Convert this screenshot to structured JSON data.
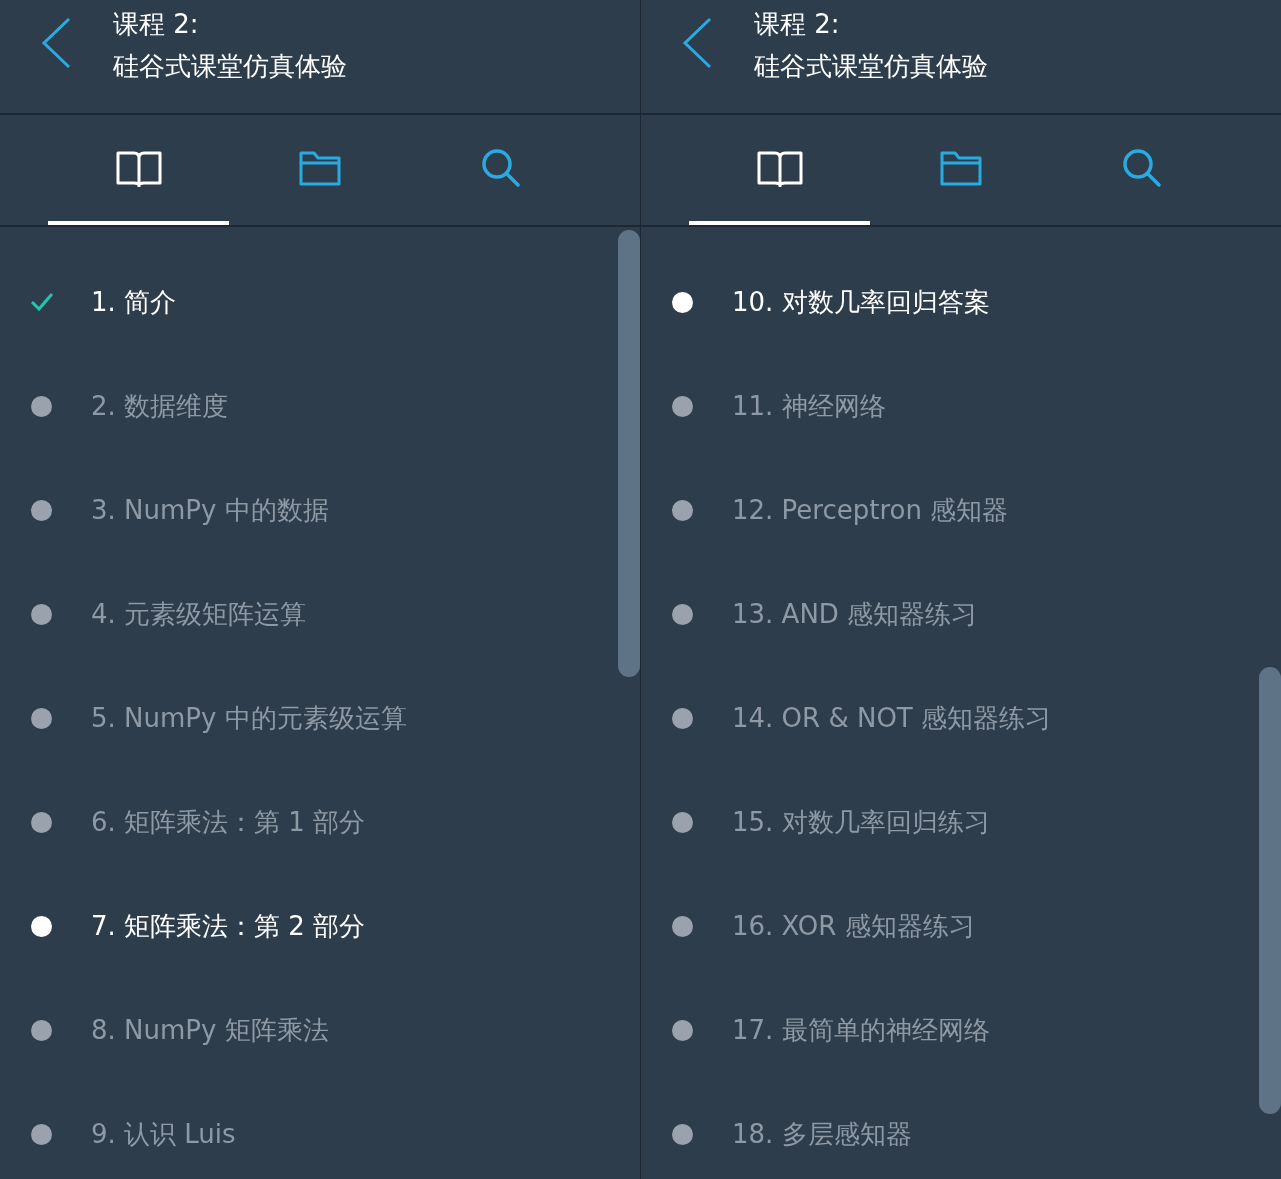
{
  "panels": [
    {
      "header": {
        "line_1": "课程 2:",
        "line_2": "硅谷式课堂仿真体验"
      },
      "tabs": [
        {
          "kind": "book",
          "selected": true
        },
        {
          "kind": "folder",
          "selected": false
        },
        {
          "kind": "search",
          "selected": false
        }
      ],
      "items": [
        {
          "label": "1. 简介",
          "kind": "done"
        },
        {
          "label": "2. 数据维度",
          "kind": "todo"
        },
        {
          "label": "3. NumPy 中的数据",
          "kind": "todo"
        },
        {
          "label": "4. 元素级矩阵运算",
          "kind": "todo"
        },
        {
          "label": "5. NumPy 中的元素级运算",
          "kind": "todo"
        },
        {
          "label": "6. 矩阵乘法：第 1 部分",
          "kind": "todo"
        },
        {
          "label": "7. 矩阵乘法：第 2 部分",
          "kind": "current"
        },
        {
          "label": "8. NumPy 矩阵乘法",
          "kind": "todo"
        },
        {
          "label": "9. 认识 Luis",
          "kind": "todo"
        }
      ]
    },
    {
      "header": {
        "line_1": "课程 2:",
        "line_2": "硅谷式课堂仿真体验"
      },
      "tabs": [
        {
          "kind": "book",
          "selected": true
        },
        {
          "kind": "folder",
          "selected": false
        },
        {
          "kind": "search",
          "selected": false
        }
      ],
      "items": [
        {
          "label": "10. 对数几率回归答案",
          "kind": "current"
        },
        {
          "label": "11. 神经网络",
          "kind": "todo"
        },
        {
          "label": "12. Perceptron 感知器",
          "kind": "todo"
        },
        {
          "label": "13. AND 感知器练习",
          "kind": "todo"
        },
        {
          "label": "14. OR & NOT 感知器练习",
          "kind": "todo"
        },
        {
          "label": "15. 对数几率回归练习",
          "kind": "todo"
        },
        {
          "label": "16. XOR 感知器练习",
          "kind": "todo"
        },
        {
          "label": "17. 最简单的神经网络",
          "kind": "todo"
        },
        {
          "label": "18. 多层感知器",
          "kind": "todo"
        }
      ]
    }
  ]
}
